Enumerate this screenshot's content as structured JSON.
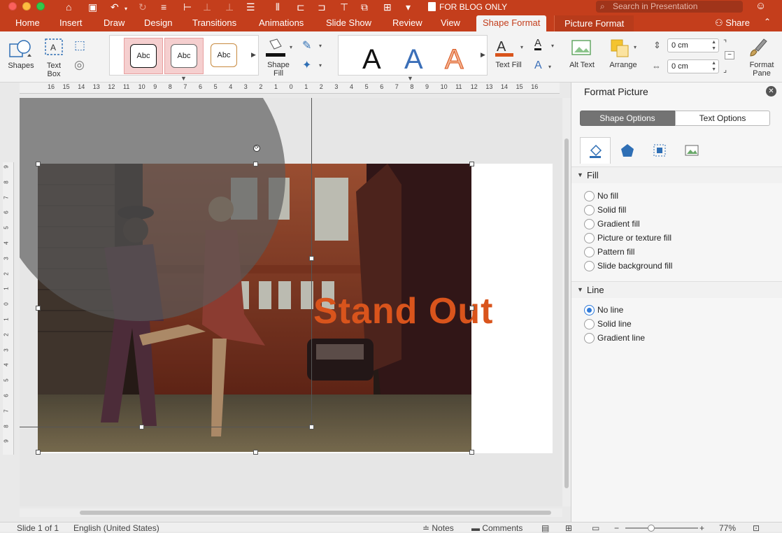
{
  "window": {
    "doc_title": "FOR BLOG ONLY",
    "search_placeholder": "Search in Presentation"
  },
  "colors": {
    "accent": "#c43e1c",
    "headline": "#d9541c",
    "radio_selected": "#2f7ad9"
  },
  "tabs": [
    {
      "label": "Home"
    },
    {
      "label": "Insert"
    },
    {
      "label": "Draw"
    },
    {
      "label": "Design"
    },
    {
      "label": "Transitions"
    },
    {
      "label": "Animations"
    },
    {
      "label": "Slide Show"
    },
    {
      "label": "Review"
    },
    {
      "label": "View"
    },
    {
      "label": "Shape Format",
      "active": true
    },
    {
      "label": "Picture Format"
    }
  ],
  "share_label": "Share",
  "ribbon": {
    "shapes_label": "Shapes",
    "textbox_label": "Text Box",
    "style_label": "Abc",
    "shape_fill_label": "Shape Fill",
    "wordart_letter": "A",
    "text_fill_label": "Text Fill",
    "alt_text_label": "Alt Text",
    "arrange_label": "Arrange",
    "height_value": "0 cm",
    "width_value": "0 cm",
    "format_pane_label": "Format Pane"
  },
  "slide": {
    "headline": "Stand Out"
  },
  "ruler": {
    "h_numbers": [
      "16",
      "15",
      "14",
      "13",
      "12",
      "11",
      "10",
      "9",
      "8",
      "7",
      "6",
      "5",
      "4",
      "3",
      "2",
      "1",
      "0",
      "1",
      "2",
      "3",
      "4",
      "5",
      "6",
      "7",
      "8",
      "9",
      "10",
      "11",
      "12",
      "13",
      "14",
      "15",
      "16"
    ],
    "v_numbers": [
      "9",
      "8",
      "7",
      "6",
      "5",
      "4",
      "3",
      "2",
      "1",
      "0",
      "1",
      "2",
      "3",
      "4",
      "5",
      "6",
      "7",
      "8",
      "9"
    ]
  },
  "pane": {
    "title": "Format Picture",
    "segments": [
      "Shape Options",
      "Text Options"
    ],
    "icons": [
      "fill-line-icon",
      "effects-icon",
      "size-properties-icon",
      "picture-icon"
    ],
    "fill": {
      "title": "Fill",
      "options": [
        "No fill",
        "Solid fill",
        "Gradient fill",
        "Picture or texture fill",
        "Pattern fill",
        "Slide background fill"
      ]
    },
    "line": {
      "title": "Line",
      "options": [
        "No line",
        "Solid line",
        "Gradient line"
      ],
      "selected": "No line"
    }
  },
  "status": {
    "slide_info": "Slide 1 of 1",
    "language": "English (United States)",
    "notes": "Notes",
    "comments": "Comments",
    "zoom": "77%"
  }
}
